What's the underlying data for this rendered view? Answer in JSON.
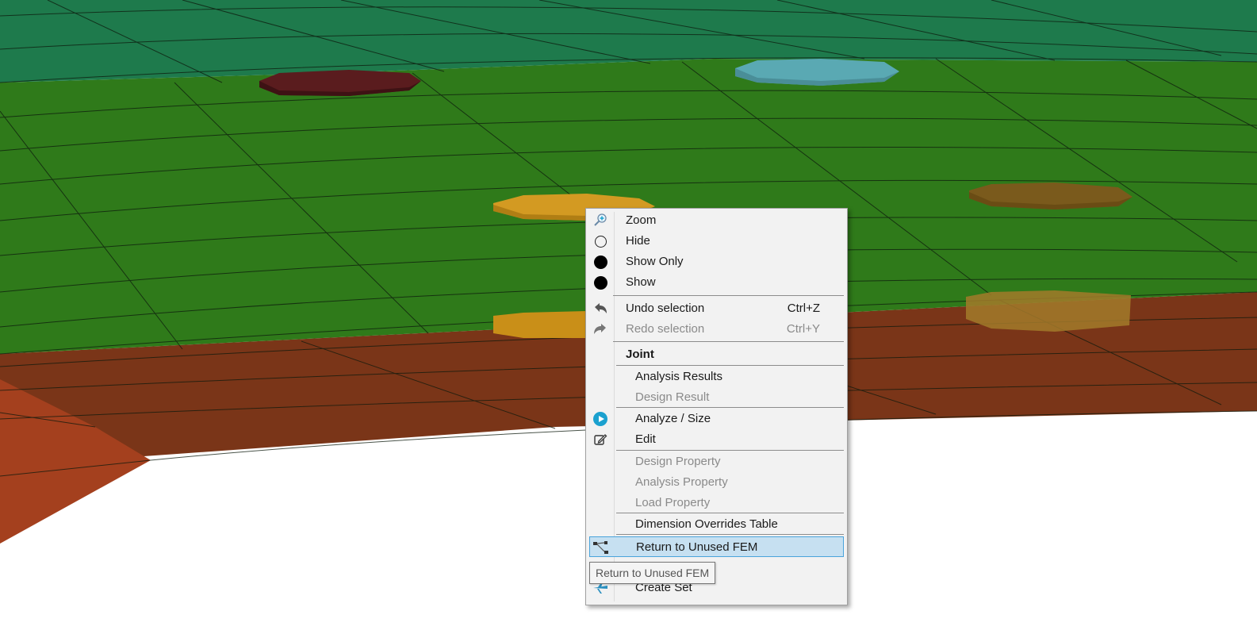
{
  "context_menu": {
    "items": [
      {
        "label": "Zoom",
        "icon": "zoom-icon",
        "enabled": true
      },
      {
        "label": "Hide",
        "icon": "hide-circle-icon",
        "enabled": true
      },
      {
        "label": "Show Only",
        "icon": "show-only-circle-icon",
        "enabled": true
      },
      {
        "label": "Show",
        "icon": "show-circle-icon",
        "enabled": true
      },
      {
        "label": "Undo selection",
        "shortcut": "Ctrl+Z",
        "icon": "undo-icon",
        "enabled": true
      },
      {
        "label": "Redo selection",
        "shortcut": "Ctrl+Y",
        "icon": "redo-icon",
        "enabled": false
      },
      {
        "label": "Joint",
        "header": true
      },
      {
        "label": "Analysis Results",
        "enabled": true
      },
      {
        "label": "Design Result",
        "enabled": false
      },
      {
        "label": "Analyze / Size",
        "icon": "play-icon",
        "enabled": true
      },
      {
        "label": "Edit",
        "icon": "edit-icon",
        "enabled": true
      },
      {
        "label": "Design Property",
        "enabled": false
      },
      {
        "label": "Analysis Property",
        "enabled": false
      },
      {
        "label": "Load Property",
        "enabled": false
      },
      {
        "label": "Dimension Overrides Table",
        "enabled": true
      },
      {
        "label": "Return to Unused FEM",
        "icon": "return-fem-icon",
        "enabled": true,
        "highlighted": true
      },
      {
        "label": "Create Set",
        "icon": "create-set-icon",
        "enabled": true
      }
    ]
  },
  "tooltip": {
    "text": "Return to Unused FEM"
  },
  "colors": {
    "menu_bg": "#f2f2f2",
    "highlight_bg": "#c6e0f1",
    "highlight_border": "#49a3db",
    "panel_teal": "#1e7a4c",
    "panel_green": "#2f7a1a",
    "panel_brown": "#7a3518",
    "fastener_red": "#5a1c1e",
    "fastener_blue": "#5aa9b3",
    "fastener_gold": "#d39a22",
    "fastener_olive": "#7a5a1c"
  }
}
